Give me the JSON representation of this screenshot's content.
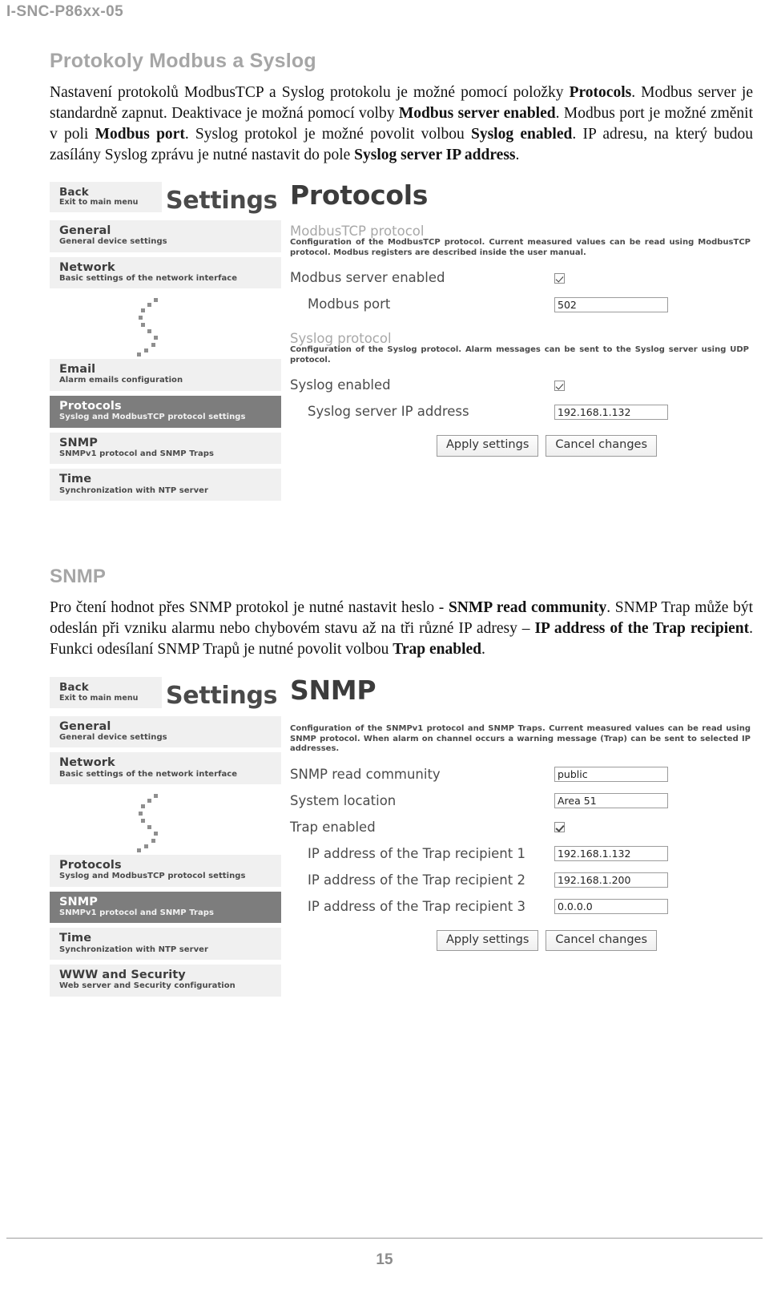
{
  "document": {
    "running_header": "I-SNC-P86xx-05",
    "page_number": "15"
  },
  "section_modbus": {
    "title": "Protokoly Modbus a Syslog",
    "paragraph_html": "Nastavení protokolů ModbusTCP a Syslog protokolu je možné pomocí položky <b>Protocols</b>. Modbus server je standardně zapnut. Deaktivace je možná pomocí volby <b>Modbus server enabled</b>. Modbus port je možné změnit v poli <b>Modbus port</b>. Syslog protokol je možné povolit volbou <b>Syslog enabled</b>. IP adresu, na který budou zasílány Syslog zprávu je nutné nastavit do pole <b>Syslog server IP address</b>."
  },
  "section_snmp": {
    "title": "SNMP",
    "paragraph_html": "Pro čtení hodnot přes SNMP protokol je nutné nastavit heslo - <b>SNMP read community</b>. SNMP Trap může být odeslán při vzniku alarmu nebo chybovém stavu až na tři různé IP adresy – <b>IP address of the Trap recipient</b>. Funkci odesílaní SNMP Trapů je nutné povolit volbou <b>Trap enabled</b>."
  },
  "screenshot_protocols": {
    "nav": {
      "back": {
        "title": "Back",
        "sub": "Exit to main menu"
      },
      "items": [
        {
          "title": "General",
          "sub": "General device settings",
          "active": false
        },
        {
          "title": "Network",
          "sub": "Basic settings of the network interface",
          "active": false
        },
        {
          "title": "Email",
          "sub": "Alarm emails configuration",
          "active": false
        },
        {
          "title": "Protocols",
          "sub": "Syslog and ModbusTCP protocol settings",
          "active": true
        },
        {
          "title": "SNMP",
          "sub": "SNMPv1 protocol and SNMP Traps",
          "active": false
        },
        {
          "title": "Time",
          "sub": "Synchronization with NTP server",
          "active": false
        }
      ]
    },
    "app_title": "Settings",
    "page_heading": "Protocols",
    "modbus_group": {
      "title": "ModbusTCP protocol",
      "description": "Configuration of the ModbusTCP protocol. Current measured values can be read using ModbusTCP protocol. Modbus registers are described inside the user manual.",
      "server_enabled_label": "Modbus server enabled",
      "server_enabled_value": true,
      "port_label": "Modbus port",
      "port_value": "502"
    },
    "syslog_group": {
      "title": "Syslog protocol",
      "description": "Configuration of the Syslog protocol. Alarm messages can be sent to the Syslog server using UDP protocol.",
      "enabled_label": "Syslog enabled",
      "enabled_value": true,
      "ip_label": "Syslog server IP address",
      "ip_value": "192.168.1.132"
    },
    "buttons": {
      "apply": "Apply settings",
      "cancel": "Cancel changes"
    }
  },
  "screenshot_snmp": {
    "nav": {
      "back": {
        "title": "Back",
        "sub": "Exit to main menu"
      },
      "items": [
        {
          "title": "General",
          "sub": "General device settings",
          "active": false
        },
        {
          "title": "Network",
          "sub": "Basic settings of the network interface",
          "active": false
        },
        {
          "title": "Protocols",
          "sub": "Syslog and ModbusTCP protocol settings",
          "active": false
        },
        {
          "title": "SNMP",
          "sub": "SNMPv1 protocol and SNMP Traps",
          "active": true
        },
        {
          "title": "Time",
          "sub": "Synchronization with NTP server",
          "active": false
        },
        {
          "title": "WWW and Security",
          "sub": "Web server and Security configuration",
          "active": false
        }
      ]
    },
    "app_title": "Settings",
    "page_heading": "SNMP",
    "description": "Configuration of the SNMPv1 protocol and SNMP Traps. Current measured values can be read using SNMP protocol. When alarm on channel occurs a warning message (Trap) can be sent to selected IP addresses.",
    "fields": {
      "read_community_label": "SNMP read community",
      "read_community_value": "public",
      "system_location_label": "System location",
      "system_location_value": "Area 51",
      "trap_enabled_label": "Trap enabled",
      "trap_enabled_value": true,
      "trap1_label": "IP address of the Trap recipient 1",
      "trap1_value": "192.168.1.132",
      "trap2_label": "IP address of the Trap recipient 2",
      "trap2_value": "192.168.1.200",
      "trap3_label": "IP address of the Trap recipient 3",
      "trap3_value": "0.0.0.0"
    },
    "buttons": {
      "apply": "Apply settings",
      "cancel": "Cancel changes"
    }
  }
}
